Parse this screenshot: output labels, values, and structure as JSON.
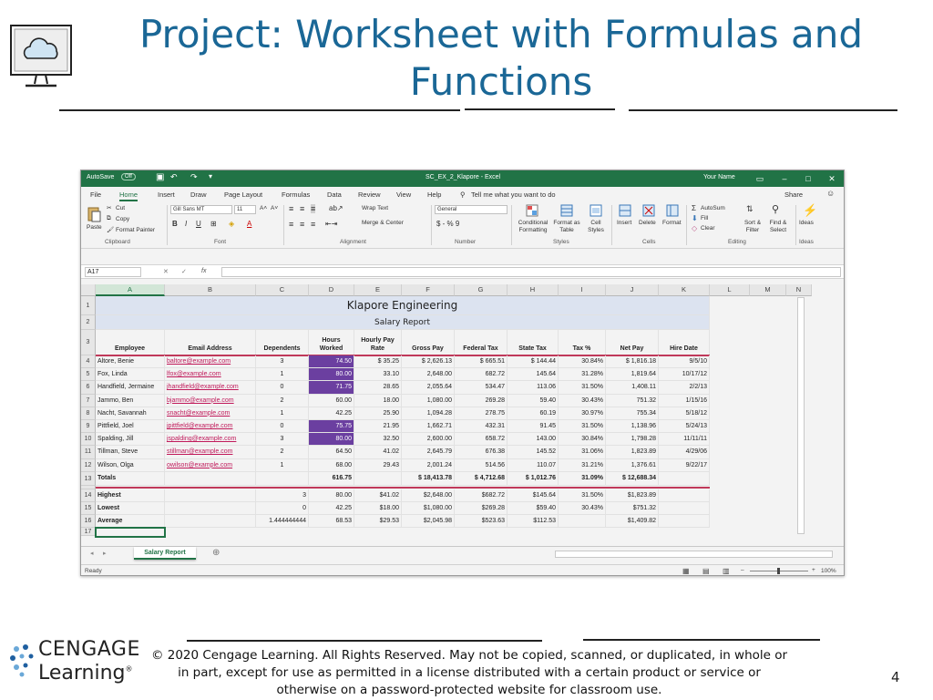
{
  "slide": {
    "title_line1": "Project: Worksheet with Formulas and",
    "title_line2": "Functions",
    "copyright_line1": "© 2020 Cengage Learning. All Rights Reserved. May not be copied, scanned, or duplicated, in whole or",
    "copyright_line2": "in part, except for use as permitted in a license distributed with a certain product or service or",
    "copyright_line3": "otherwise on a password-protected website for classroom use.",
    "page_number": "4",
    "logo_word1": "CENGAGE",
    "logo_word2": "Learning",
    "logo_mark": "®"
  },
  "excel": {
    "autosave": "AutoSave",
    "autosave_state": "Off",
    "file_title": "SC_EX_2_Klapore  -  Excel",
    "user_name": "Your Name",
    "tabs": [
      "File",
      "Home",
      "Insert",
      "Draw",
      "Page Layout",
      "Formulas",
      "Data",
      "Review",
      "View",
      "Help"
    ],
    "tell_me": "Tell me what you want to do",
    "share": "Share",
    "ribbon": {
      "paste": "Paste",
      "cut": "Cut",
      "copy": "Copy",
      "format_painter": "Format Painter",
      "clipboard": "Clipboard",
      "font_name": "Gill Sans MT",
      "font_size": "11",
      "font": "Font",
      "wrap_text": "Wrap Text",
      "merge_center": "Merge & Center",
      "alignment": "Alignment",
      "number_format": "General",
      "number_symbols": "$  -  %  9",
      "number": "Number",
      "conditional_formatting": "Conditional Formatting",
      "format_as_table": "Format as Table",
      "cell_styles": "Cell Styles",
      "styles": "Styles",
      "insert": "Insert",
      "delete": "Delete",
      "format": "Format",
      "cells": "Cells",
      "autosum": "AutoSum",
      "fill": "Fill",
      "clear": "Clear",
      "sort_filter": "Sort & Filter",
      "find_select": "Find & Select",
      "editing": "Editing",
      "ideas": "Ideas",
      "ideas_group": "Ideas"
    },
    "name_box": "A17",
    "fx": "fx",
    "columns": [
      "A",
      "B",
      "C",
      "D",
      "E",
      "F",
      "G",
      "H",
      "I",
      "J",
      "K",
      "L",
      "M",
      "N"
    ],
    "sheet_title": "Klapore Engineering",
    "sheet_subtitle": "Salary Report",
    "headers": [
      "Employee",
      "Email Address",
      "Dependents",
      "Hours Worked",
      "Hourly Pay Rate",
      "Gross Pay",
      "Federal  Tax",
      "State Tax",
      "Tax %",
      "Net Pay",
      "Hire Date"
    ],
    "rows": [
      {
        "num": "4",
        "cells": [
          "Altore, Benie",
          "baltore@example.com",
          "3",
          "74.50",
          "$       35.25",
          "$    2,626.13",
          "$       665.51",
          "$      144.44",
          "30.84%",
          "$    1,816.18",
          "9/5/10"
        ]
      },
      {
        "num": "5",
        "cells": [
          "Fox, Linda",
          "lfox@example.com",
          "1",
          "80.00",
          "33.10",
          "2,648.00",
          "682.72",
          "145.64",
          "31.28%",
          "1,819.64",
          "10/17/12"
        ]
      },
      {
        "num": "6",
        "cells": [
          "Handfield, Jermaine",
          "jhandfield@example.com",
          "0",
          "71.75",
          "28.65",
          "2,055.64",
          "534.47",
          "113.06",
          "31.50%",
          "1,408.11",
          "2/2/13"
        ]
      },
      {
        "num": "7",
        "cells": [
          "Jammo, Ben",
          "bjammo@example.com",
          "2",
          "60.00",
          "18.00",
          "1,080.00",
          "269.28",
          "59.40",
          "30.43%",
          "751.32",
          "1/15/16"
        ]
      },
      {
        "num": "8",
        "cells": [
          "Nacht, Savannah",
          "snacht@example.com",
          "1",
          "42.25",
          "25.90",
          "1,094.28",
          "278.75",
          "60.19",
          "30.97%",
          "755.34",
          "5/18/12"
        ]
      },
      {
        "num": "9",
        "cells": [
          "Pittfield, Joel",
          "jpittfield@example.com",
          "0",
          "75.75",
          "21.95",
          "1,662.71",
          "432.31",
          "91.45",
          "31.50%",
          "1,138.96",
          "5/24/13"
        ]
      },
      {
        "num": "10",
        "cells": [
          "Spalding, Jill",
          "jspalding@example.com",
          "3",
          "80.00",
          "32.50",
          "2,600.00",
          "658.72",
          "143.00",
          "30.84%",
          "1,798.28",
          "11/11/11"
        ]
      },
      {
        "num": "11",
        "cells": [
          "Tillman, Steve",
          "stillman@example.com",
          "2",
          "64.50",
          "41.02",
          "2,645.79",
          "676.38",
          "145.52",
          "31.06%",
          "1,823.89",
          "4/29/06"
        ]
      },
      {
        "num": "12",
        "cells": [
          "Wilson, Olga",
          "owilson@example.com",
          "1",
          "68.00",
          "29.43",
          "2,001.24",
          "514.56",
          "110.07",
          "31.21%",
          "1,376.61",
          "9/22/17"
        ]
      }
    ],
    "totals": {
      "num": "13",
      "cells": [
        "Totals",
        "",
        "",
        "616.75",
        "",
        "$  18,413.78",
        "$    4,712.68",
        "$  1,012.76",
        "31.09%",
        "$  12,688.34",
        ""
      ]
    },
    "stats": [
      {
        "num": "14",
        "cells": [
          "Highest",
          "",
          "3",
          "80.00",
          "$41.02",
          "$2,648.00",
          "$682.72",
          "$145.64",
          "31.50%",
          "$1,823.89",
          ""
        ]
      },
      {
        "num": "15",
        "cells": [
          "Lowest",
          "",
          "0",
          "42.25",
          "$18.00",
          "$1,080.00",
          "$269.28",
          "$59.40",
          "30.43%",
          "$751.32",
          ""
        ]
      },
      {
        "num": "16",
        "cells": [
          "Average",
          "",
          "1.444444444",
          "68.53",
          "$29.53",
          "$2,045.98",
          "$523.63",
          "$112.53",
          "",
          "$1,409.82",
          ""
        ]
      }
    ],
    "row17": "17",
    "sheet_tab": "Salary Report",
    "status": "Ready",
    "zoom": "100%"
  }
}
